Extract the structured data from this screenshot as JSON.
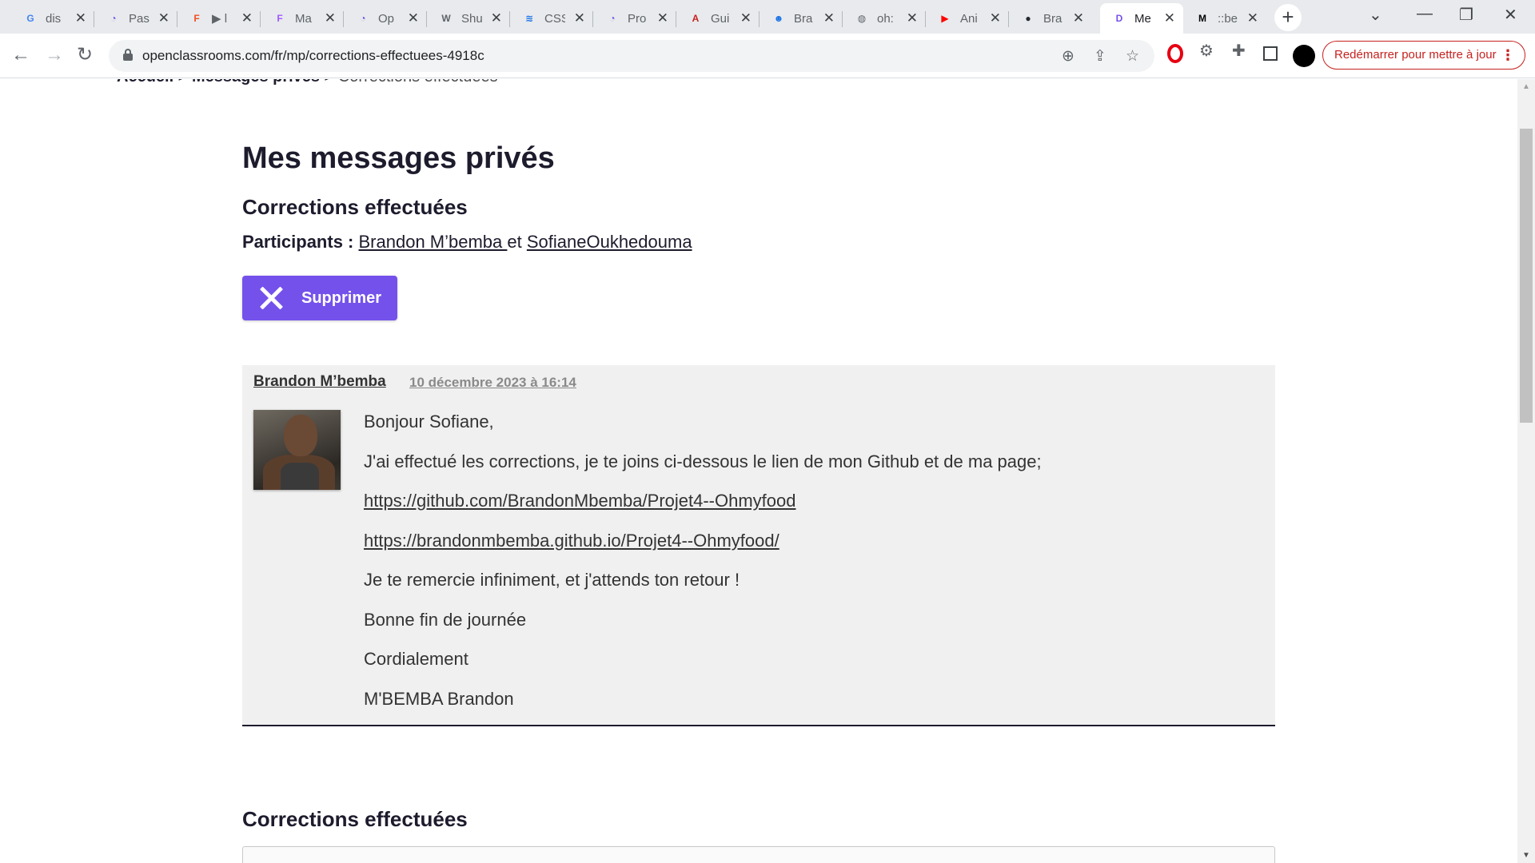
{
  "browser": {
    "tabs": [
      {
        "title": "dis",
        "icon": "google-icon",
        "color": "#4285f4",
        "glyph": "G"
      },
      {
        "title": "Pas",
        "icon": "openclassrooms-icon",
        "color": "#7451eb",
        "glyph": "◔"
      },
      {
        "title": "▶ l",
        "icon": "figma-icon",
        "color": "#f24e1e",
        "glyph": "F"
      },
      {
        "title": "Ma",
        "icon": "figma-icon",
        "color": "#a259ff",
        "glyph": "F"
      },
      {
        "title": "Op",
        "icon": "openclassrooms-icon",
        "color": "#7451eb",
        "glyph": "◔"
      },
      {
        "title": "Shu",
        "icon": "webflow-icon",
        "color": "#5f6368",
        "glyph": "W"
      },
      {
        "title": "CSS",
        "icon": "stack-icon",
        "color": "#1a73e8",
        "glyph": "≋"
      },
      {
        "title": "Pro",
        "icon": "openclassrooms-icon",
        "color": "#7451eb",
        "glyph": "◔"
      },
      {
        "title": "Gui",
        "icon": "pdf-icon",
        "color": "#c5221f",
        "glyph": "A"
      },
      {
        "title": "Bra",
        "icon": "chat-icon",
        "color": "#1a73e8",
        "glyph": "☻"
      },
      {
        "title": "oh:",
        "icon": "globe-icon",
        "color": "#5f6368",
        "glyph": "◍"
      },
      {
        "title": "Ani",
        "icon": "youtube-icon",
        "color": "#ff0000",
        "glyph": "▶"
      },
      {
        "title": "Bra",
        "icon": "github-icon",
        "color": "#24292f",
        "glyph": "●"
      },
      {
        "title": "Me",
        "icon": "openclassrooms-icon",
        "color": "#7451eb",
        "glyph": "D",
        "active": true
      },
      {
        "title": "::be",
        "icon": "medium-icon",
        "color": "#000000",
        "glyph": "M"
      }
    ],
    "new_tab_glyph": "+",
    "tab_close_glyph": "✕",
    "url": "openclassrooms.com/fr/mp/corrections-effectuees-4918c",
    "update_button_label": "Redémarrer pour mettre à jour",
    "update_button_dots": "⋮"
  },
  "page": {
    "breadcrumb": {
      "home": "Accueil >",
      "messages": "Messages privés >",
      "current": "Corrections effectuées"
    },
    "title": "Mes messages privés",
    "subject": "Corrections effectuées",
    "participants": {
      "label": "Participants :",
      "first": "Brandon M’bemba ",
      "connector": " et ",
      "second": "SofianeOukhedouma"
    },
    "delete_label": "Supprimer",
    "message": {
      "author": "Brandon M’bemba",
      "date": "10 décembre 2023 à 16:14",
      "lines": {
        "greeting": "Bonjour Sofiane,",
        "intro": "J'ai effectué les corrections, je te joins ci-dessous le lien de mon Github et de ma page;",
        "link_github": "https://github.com/BrandonMbemba/Projet4--Ohmyfood",
        "link_page": "https://brandonmbemba.github.io/Projet4--Ohmyfood/",
        "thanks": "Je te remercie infiniment, et j'attends ton retour !",
        "wish": "Bonne fin de journée",
        "closing": "Cordialement",
        "signature": "M'BEMBA Brandon"
      }
    },
    "reply_title": "Corrections effectuées"
  },
  "colors": {
    "accent": "#7451eb",
    "text_dark": "#1d1c2d",
    "message_bg": "#f0f0f0",
    "update_red": "#c5221f"
  }
}
